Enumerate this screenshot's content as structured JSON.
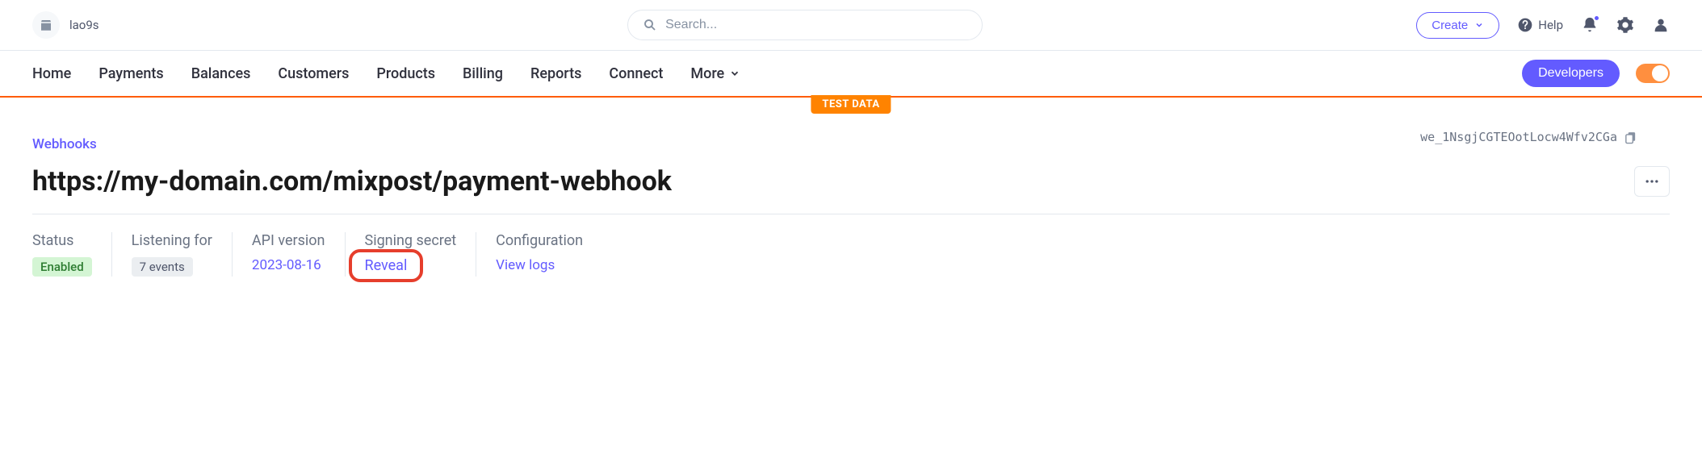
{
  "header": {
    "brand_name": "lao9s",
    "search_placeholder": "Search...",
    "create_label": "Create",
    "help_label": "Help"
  },
  "nav": {
    "items": [
      "Home",
      "Payments",
      "Balances",
      "Customers",
      "Products",
      "Billing",
      "Reports",
      "Connect"
    ],
    "more_label": "More",
    "developers_label": "Developers",
    "testdata_label": "TEST DATA"
  },
  "page": {
    "breadcrumb": "Webhooks",
    "webhook_id": "we_1NsgjCGTEOotLocw4Wfv2CGa",
    "title": "https://my-domain.com/mixpost/payment-webhook",
    "details": {
      "status": {
        "label": "Status",
        "value": "Enabled"
      },
      "listening": {
        "label": "Listening for",
        "value": "7 events"
      },
      "api_version": {
        "label": "API version",
        "value": "2023-08-16"
      },
      "signing": {
        "label": "Signing secret",
        "action": "Reveal"
      },
      "config": {
        "label": "Configuration",
        "action": "View logs"
      }
    }
  }
}
